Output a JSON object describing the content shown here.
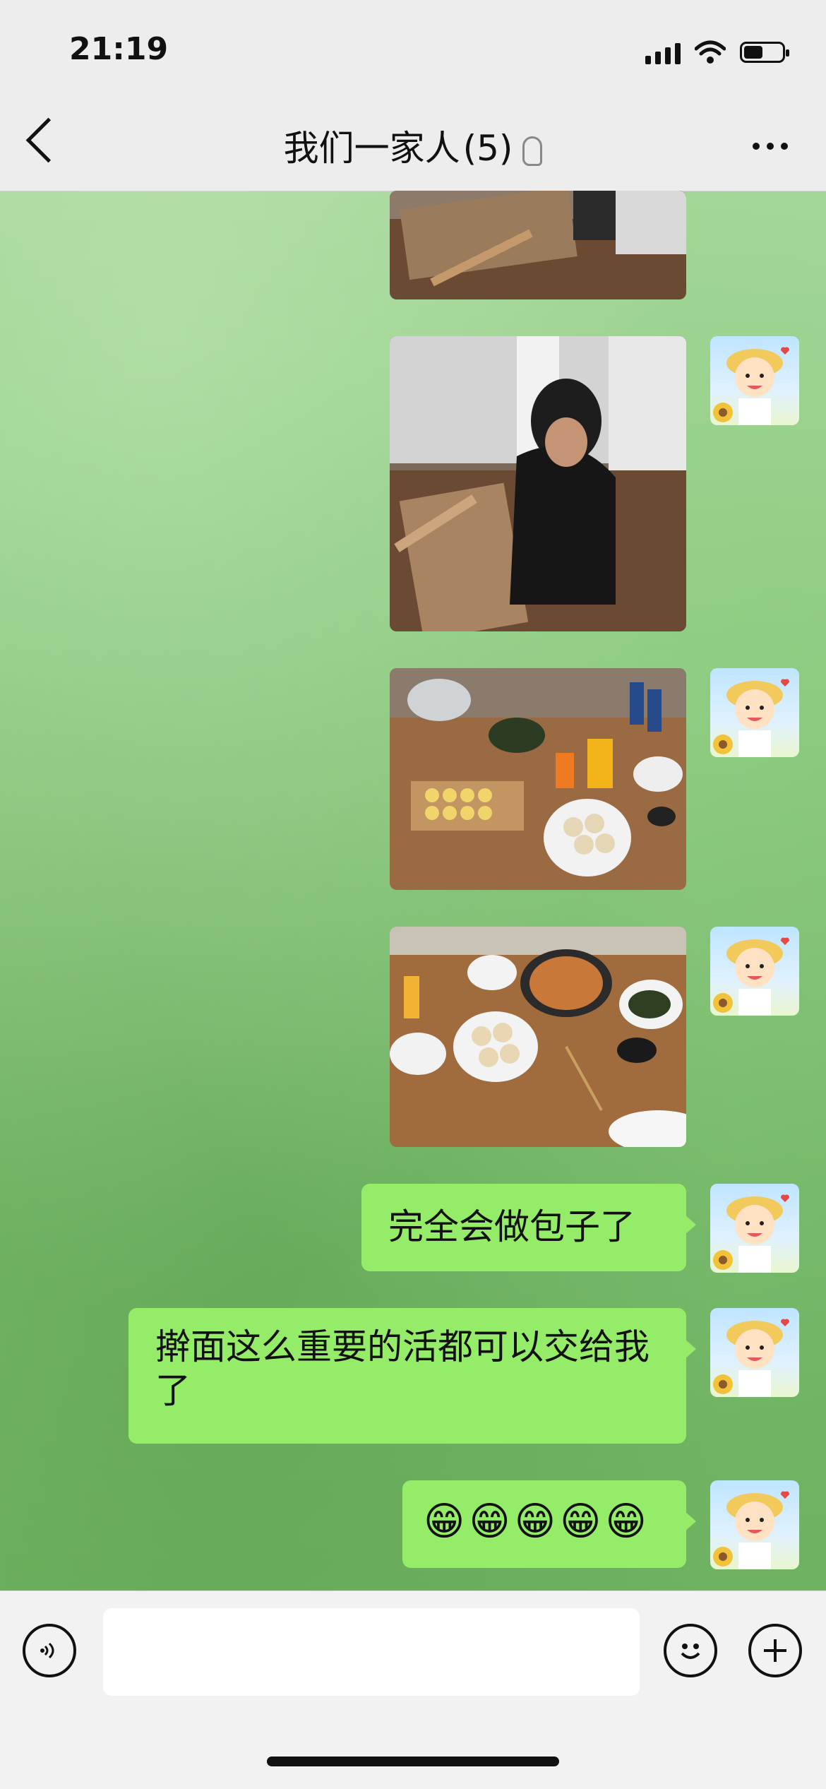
{
  "status_bar": {
    "time": "21:19",
    "icons": [
      "signal-icon",
      "wifi-icon",
      "battery-icon"
    ]
  },
  "nav": {
    "title": "我们一家人",
    "member_count": "(5)",
    "icons": [
      "back-icon",
      "ear-icon",
      "more-icon"
    ]
  },
  "messages": [
    {
      "type": "image",
      "description_icon": "photo-kneading-dough"
    },
    {
      "type": "image",
      "description_icon": "photo-person-kneading"
    },
    {
      "type": "image",
      "description_icon": "photo-table-food-1"
    },
    {
      "type": "image",
      "description_icon": "photo-table-food-2"
    },
    {
      "type": "text",
      "text": "完全会做包子了"
    },
    {
      "type": "text",
      "text": "擀面这么重要的活都可以交给我了"
    },
    {
      "type": "emoji",
      "text": "😁😁😁😁😁"
    }
  ],
  "input": {
    "value": "",
    "icons": [
      "voice-icon",
      "emoji-icon",
      "plus-icon"
    ]
  },
  "colors": {
    "bubble": "#95ec69",
    "bar": "#ededed"
  }
}
